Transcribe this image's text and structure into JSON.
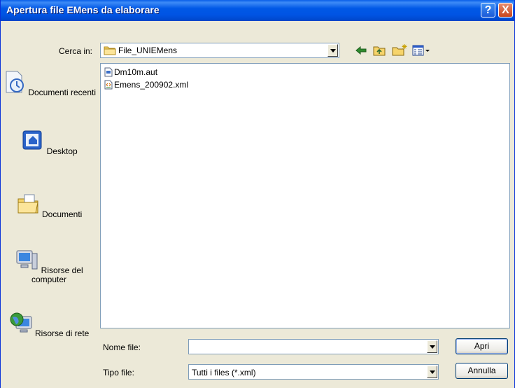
{
  "window": {
    "title": "Apertura file EMens da elaborare"
  },
  "titlebar": {
    "help_glyph": "?",
    "close_glyph": "X"
  },
  "lookin": {
    "label": "Cerca in:",
    "value": "File_UNIEMens"
  },
  "places": [
    {
      "label": "Documenti recenti",
      "icon": "recent-documents-icon"
    },
    {
      "label": "Desktop",
      "icon": "desktop-icon"
    },
    {
      "label": "Documenti",
      "icon": "my-documents-icon"
    },
    {
      "label": "Risorse del computer",
      "icon": "my-computer-icon"
    },
    {
      "label": "Risorse di rete",
      "icon": "network-places-icon"
    }
  ],
  "files": [
    {
      "name": "Dm10m.aut",
      "icon": "generic-file-icon"
    },
    {
      "name": "Emens_200902.xml",
      "icon": "xml-file-icon"
    }
  ],
  "filename": {
    "label": "Nome file:",
    "value": ""
  },
  "filetype": {
    "label": "Tipo file:",
    "value": "Tutti i files (*.xml)"
  },
  "buttons": {
    "open": "Apri",
    "cancel": "Annulla"
  },
  "colors": {
    "titlebar": "#0054E3",
    "dialog_bg": "#ECE9D8",
    "close_button": "#C8461E"
  }
}
